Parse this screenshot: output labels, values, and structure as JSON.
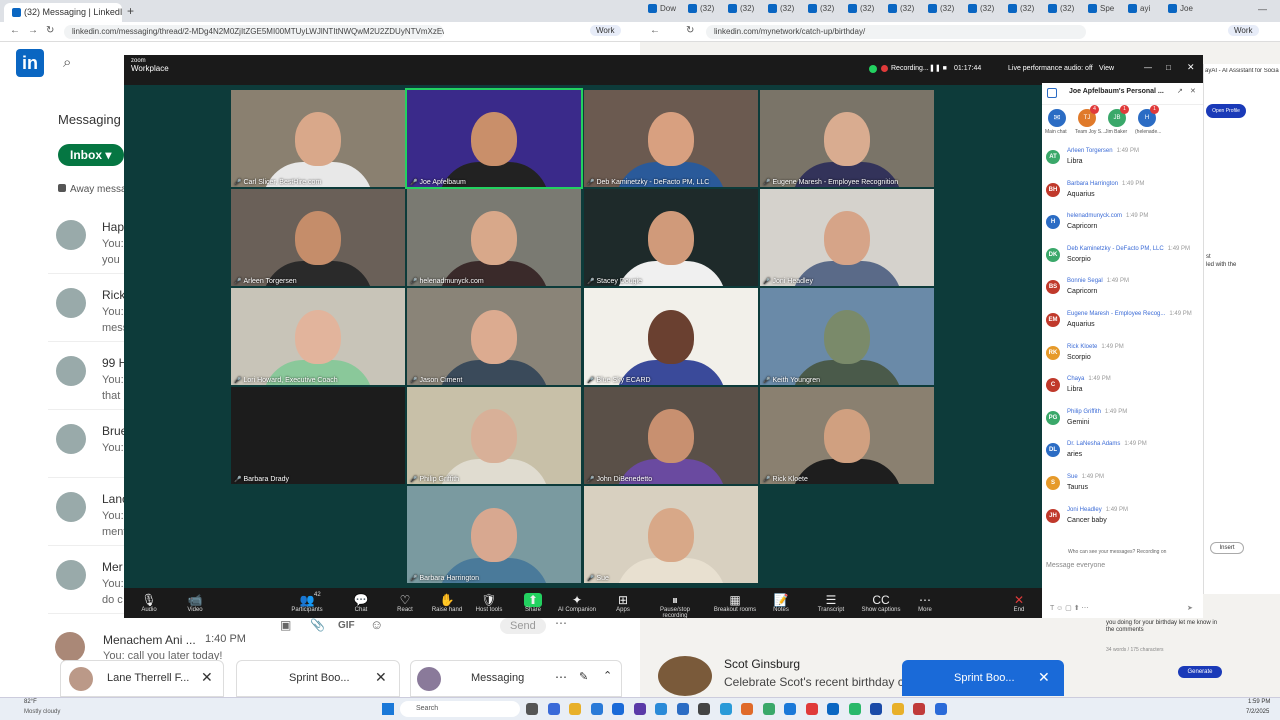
{
  "browser_left": {
    "tab_title": "(32) Messaging | LinkedIn",
    "url": "linkedin.com/messaging/thread/2-MDg4N2M0ZjItZGE5MI00MTUyLWJlNTItNWQwM2U2ZDUyNTVmXzEwMA==/",
    "profile": "Work"
  },
  "browser_right": {
    "tabs": [
      "Dow",
      "(32)",
      "(32)",
      "(32)",
      "(32)",
      "(32)",
      "(32)",
      "(32)",
      "(32)",
      "(32)",
      "(32)",
      "Spe",
      "ayi",
      "Joe"
    ],
    "url": "linkedin.com/mynetwork/catch-up/birthday/",
    "profile": "Work",
    "extension_title": "ayAI - AI Assistant for Social Media",
    "ext_button": "Open Profile",
    "ext_snippets": [
      "st",
      "led with the"
    ],
    "insert_button": "Insert",
    "comment_lines": [
      "you doing for your birthday let me know in",
      "the comments"
    ],
    "comment_status": "34 words / 175 characters",
    "generate_button": "Generate",
    "birthday_name": "Scot Ginsburg",
    "birthday_text": "Celebrate Scot's recent birthday c"
  },
  "linkedin": {
    "section_title": "Messaging",
    "inbox_label": "Inbox",
    "away_label": "Away messa",
    "conversations": [
      {
        "name": "Hap",
        "snippet": "You:",
        "snippet2": "you"
      },
      {
        "name": "Rick",
        "snippet": "You:",
        "snippet2": "mess"
      },
      {
        "name": "99 H",
        "snippet": "You:",
        "snippet2": "that"
      },
      {
        "name": "Brue",
        "snippet": "You:",
        "snippet2": ""
      },
      {
        "name": "Lanc",
        "snippet": "You:",
        "snippet2": "ment"
      },
      {
        "name": "Mer",
        "snippet": "You:",
        "snippet2": "do c"
      }
    ],
    "last_conv": {
      "name": "Menachem Ani ...",
      "time": "1:40 PM",
      "snippet": "You: call you later today!"
    },
    "send_label": "Send",
    "gif_label": "GIF",
    "dock": [
      {
        "label": "Lane Therrell F..."
      },
      {
        "label": "Sprint Boo..."
      },
      {
        "label": "Messaging"
      }
    ],
    "dock_right": {
      "label": "Sprint Boo..."
    }
  },
  "zoom": {
    "brand_line1": "zoom",
    "brand_line2": "Workplace",
    "recording_label": "Recording...",
    "timer": "01:17:44",
    "audio_status": "Live performance audio: off",
    "view_label": "View",
    "participants": [
      {
        "name": "Carl Slicer, BestHire.com",
        "bg": "#8a8070",
        "skin": "#d9a88a",
        "shirt": "#e8e8e8"
      },
      {
        "name": "Joe Apfelbaum",
        "bg": "#3a2a8a",
        "skin": "#c98f6a",
        "shirt": "#222222"
      },
      {
        "name": "Deb Kaminetzky - DeFacto PM, LLC",
        "bg": "#6b5a50",
        "skin": "#d8a080",
        "shirt": "#2a5a9a"
      },
      {
        "name": "Eugene Maresh - Employee Recognition",
        "bg": "#7a7468",
        "skin": "#d9ac90",
        "shirt": "#33335a"
      },
      {
        "name": "Arleen Torgersen",
        "bg": "#6a6058",
        "skin": "#c58d6a",
        "shirt": "#2a2a2a"
      },
      {
        "name": "helenadmunyck.com",
        "bg": "#7a7a72",
        "skin": "#d8a88a",
        "shirt": "#3a2a2a"
      },
      {
        "name": "Stacey Dougie",
        "bg": "#1e2a2a",
        "skin": "#d09a7a",
        "shirt": "#f0f0f0"
      },
      {
        "name": "Joni Headley",
        "bg": "#d5d2cc",
        "skin": "#d6a488",
        "shirt": "#5a6a88"
      },
      {
        "name": "Lori Howard, Executive Coach",
        "bg": "#c8c4b8",
        "skin": "#e2b49c",
        "shirt": "#8ac89a"
      },
      {
        "name": "Jason Ciment",
        "bg": "#8a8478",
        "skin": "#dcab90",
        "shirt": "#3a4a5a"
      },
      {
        "name": "Blue Sky ECARD",
        "bg": "#f2f0ea",
        "skin": "#6a4030",
        "shirt": "#3a4a9a"
      },
      {
        "name": "Keith Youngren",
        "bg": "#6a8aa8",
        "skin": "#7a8a6a",
        "shirt": "#4a5a4a"
      },
      {
        "name": "Barbara Drady",
        "bg": "#1c1c1c",
        "skin": "#1c1c1c",
        "shirt": "#1c1c1c"
      },
      {
        "name": "Philip Griffith",
        "bg": "#c8c0a8",
        "skin": "#d8b098",
        "shirt": "#e0dcd0"
      },
      {
        "name": "John DiBenedetto",
        "bg": "#5a5048",
        "skin": "#c89070",
        "shirt": "#6a4aa0"
      },
      {
        "name": "Rick Kloete",
        "bg": "#8a8070",
        "skin": "#d0a080",
        "shirt": "#1e1e1e"
      },
      {
        "name": "Barbara Harrington",
        "bg": "#7a9aa0",
        "skin": "#d8a890",
        "shirt": "#4a7a9a"
      },
      {
        "name": "Sue",
        "bg": "#d8d0c0",
        "skin": "#d8a888",
        "shirt": "#e8e0d0"
      }
    ],
    "toolbar": [
      {
        "label": "Audio",
        "icon": "🎙"
      },
      {
        "label": "Video",
        "icon": "📹"
      },
      {
        "label": "Participants",
        "icon": "👥"
      },
      {
        "label": "Chat",
        "icon": "💬"
      },
      {
        "label": "React",
        "icon": "♡"
      },
      {
        "label": "Raise hand",
        "icon": "✋"
      },
      {
        "label": "Host tools",
        "icon": "🛡"
      },
      {
        "label": "Share",
        "icon": "⬆"
      },
      {
        "label": "AI Companion",
        "icon": "✦"
      },
      {
        "label": "Apps",
        "icon": "⊞"
      },
      {
        "label": "Pause/stop recording",
        "icon": "⏸"
      },
      {
        "label": "Breakout rooms",
        "icon": "▦"
      },
      {
        "label": "Notes",
        "icon": "📝"
      },
      {
        "label": "Transcript",
        "icon": "☰"
      },
      {
        "label": "Show captions",
        "icon": "CC"
      },
      {
        "label": "More",
        "icon": "⋯"
      },
      {
        "label": "End",
        "icon": "✕"
      }
    ],
    "participants_count": "42"
  },
  "chat": {
    "title": "Joe Apfelbaum's Personal ...",
    "tab_labels": [
      "Main chat",
      "Team Joy S...",
      "Jim Baker",
      "(helenade..."
    ],
    "tab_initials": [
      "TJ",
      "JB",
      "H"
    ],
    "tab_badges": [
      "4",
      "1",
      "1"
    ],
    "messages": [
      {
        "initials": "AT",
        "color": "#3aa86a",
        "name": "Arleen Torgersen",
        "time": "1:49 PM",
        "text": "Libra"
      },
      {
        "initials": "BH",
        "color": "#c0392b",
        "name": "Barbara Harrington",
        "time": "1:49 PM",
        "text": "Aquarius"
      },
      {
        "initials": "H",
        "color": "#2b6cc4",
        "name": "helenadmunyck.com",
        "time": "1:49 PM",
        "text": "Capricorn"
      },
      {
        "initials": "DK",
        "color": "#3aa86a",
        "name": "Deb Kaminetzky - DeFacto PM, LLC",
        "time": "1:49 PM",
        "text": "Scorpio"
      },
      {
        "initials": "BS",
        "color": "#c0392b",
        "name": "Bonnie Segal",
        "time": "1:49 PM",
        "text": "Capricorn"
      },
      {
        "initials": "EM",
        "color": "#c0392b",
        "name": "Eugene Maresh - Employee Recog...",
        "time": "1:49 PM",
        "text": "Aquarius"
      },
      {
        "initials": "RK",
        "color": "#e69a2a",
        "name": "Rick Kloete",
        "time": "1:49 PM",
        "text": "Scorpio"
      },
      {
        "initials": "C",
        "color": "#c0392b",
        "name": "Chaya",
        "time": "1:49 PM",
        "text": "Libra"
      },
      {
        "initials": "PG",
        "color": "#3aa86a",
        "name": "Philip Griffith",
        "time": "1:49 PM",
        "text": "Gemini"
      },
      {
        "initials": "DL",
        "color": "#2b6cc4",
        "name": "Dr. LaNesha Adams",
        "time": "1:49 PM",
        "text": "aries"
      },
      {
        "initials": "S",
        "color": "#e69a2a",
        "name": "Sue",
        "time": "1:49 PM",
        "text": "Taurus"
      },
      {
        "initials": "JH",
        "color": "#c0392b",
        "name": "Joni Headley",
        "time": "1:49 PM",
        "text": "Cancer baby"
      }
    ],
    "visibility_note": "Who can see your messages? Recording on",
    "input_placeholder": "Message everyone"
  },
  "taskbar": {
    "weather_temp": "82°F",
    "weather_desc": "Mostly cloudy",
    "search": "Search",
    "time": "1:59 PM",
    "date": "7/2/2025"
  },
  "colors": {
    "linkedin_blue": "#0a66c2",
    "inbox_green": "#057642",
    "zoom_bg": "#0d3b3a",
    "active_speaker": "#23d160"
  }
}
